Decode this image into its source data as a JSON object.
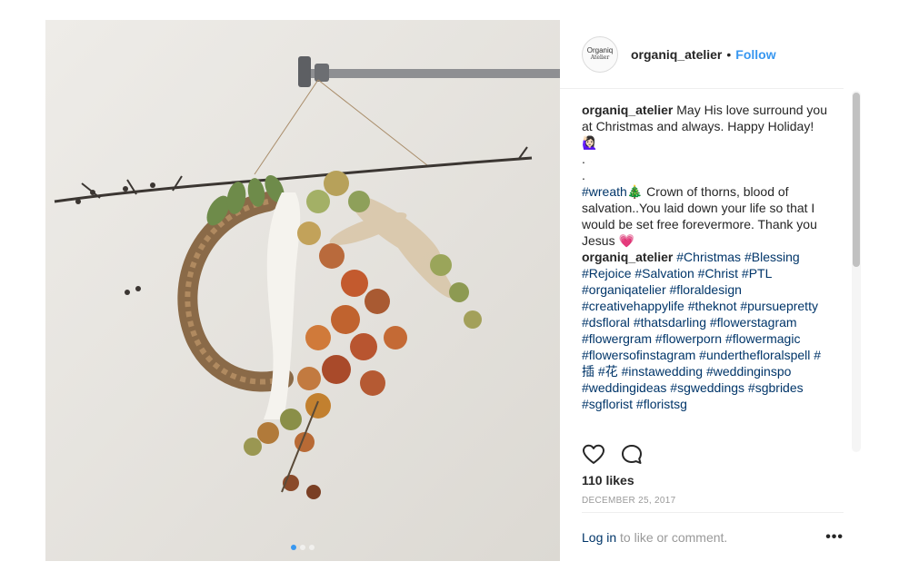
{
  "post": {
    "image_alt": "Dried flower wreath hanging from a pipe",
    "carousel": {
      "total": 3,
      "active_index": 0
    }
  },
  "header": {
    "avatar_text_1": "Organiq",
    "avatar_text_2": "Atelier",
    "username": "organiq_atelier",
    "separator": "•",
    "follow_label": "Follow"
  },
  "caption": {
    "username": "organiq_atelier",
    "line_1": "May His love surround you at Christmas and always. Happy Holiday! 🙋🏻‍♀️",
    "dot_1": ".",
    "dot_2": ".",
    "hashtag": "#wreath",
    "tree_emoji": "🎄",
    "text_2": " Crown of thorns, blood of salvation..You laid down your life so that I would be set free forevermore. Thank you Jesus ",
    "heart_emoji": "💗"
  },
  "comment": {
    "username": "organiq_atelier",
    "tags": [
      "#Christmas",
      "#Blessing",
      "#Rejoice",
      "#Salvation",
      "#Christ",
      "#PTL",
      "#organiqatelier",
      "#floraldesign",
      "#creativehappylife",
      "#theknot",
      "#pursuepretty",
      "#dsfloral",
      "#thatsdarling",
      "#flowerstagram",
      "#flowergram",
      "#flowerporn",
      "#flowermagic",
      "#flowersofinstagram",
      "#underthefloralspell",
      "#插",
      "#花",
      "#instawedding",
      "#weddinginspo",
      "#weddingideas",
      "#sgweddings",
      "#sgbrides",
      "#sgflorist",
      "#floristsg"
    ]
  },
  "actions": {
    "like_icon": "heart-outline-icon",
    "comment_icon": "speech-bubble-icon"
  },
  "likes_text": "110 likes",
  "date_text": "December 25, 2017",
  "footer": {
    "login_link": "Log in",
    "login_rest": " to like or comment.",
    "more_label": "•••"
  },
  "colors": {
    "link_blue": "#3897f0",
    "hashtag_navy": "#003569",
    "muted": "#999999"
  }
}
